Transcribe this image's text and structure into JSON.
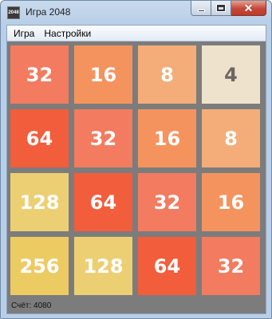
{
  "window": {
    "title": "Игра 2048",
    "icon_label": "2048"
  },
  "menu": {
    "items": [
      "Игра",
      "Настройки"
    ]
  },
  "board": {
    "rows": [
      [
        32,
        16,
        8,
        4
      ],
      [
        64,
        32,
        16,
        8
      ],
      [
        128,
        64,
        32,
        16
      ],
      [
        256,
        128,
        64,
        32
      ]
    ],
    "tile_colors": {
      "4": {
        "bg": "#efe2cc",
        "fg": "#6e6660"
      },
      "8": {
        "bg": "#f4ad79",
        "fg": "#ffffff"
      },
      "16": {
        "bg": "#f5935e",
        "fg": "#ffffff"
      },
      "32": {
        "bg": "#f37b5f",
        "fg": "#ffffff"
      },
      "64": {
        "bg": "#f25d3b",
        "fg": "#ffffff"
      },
      "128": {
        "bg": "#edcf73",
        "fg": "#ffffff"
      },
      "256": {
        "bg": "#edcb63",
        "fg": "#ffffff"
      }
    },
    "background": "#7c7c7c"
  },
  "status": {
    "score_text": "Счёт: 4080"
  }
}
